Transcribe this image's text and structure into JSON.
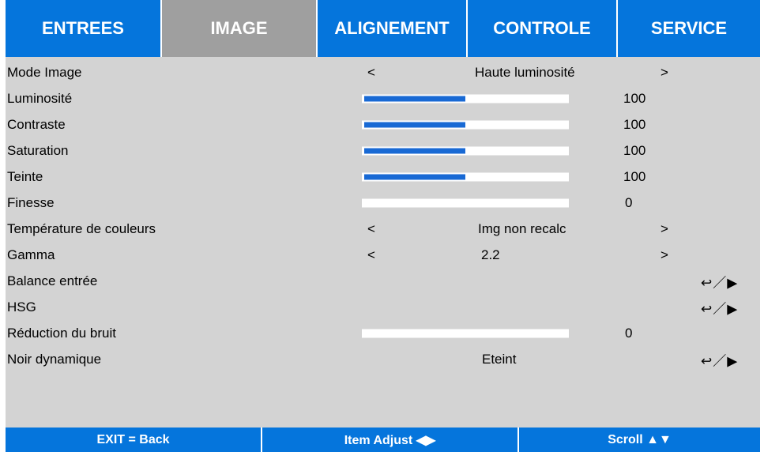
{
  "tabs": [
    {
      "label": "ENTREES",
      "active": false
    },
    {
      "label": "IMAGE",
      "active": true
    },
    {
      "label": "ALIGNEMENT",
      "active": false
    },
    {
      "label": "CONTROLE",
      "active": false
    },
    {
      "label": "SERVICE",
      "active": false
    }
  ],
  "menu": {
    "mode_image": {
      "label": "Mode Image",
      "left": "<",
      "value": "Haute luminosité",
      "right": ">"
    },
    "luminosite": {
      "label": "Luminosité",
      "value": "100",
      "level": 0.5
    },
    "contraste": {
      "label": "Contraste",
      "value": "100",
      "level": 0.5
    },
    "saturation": {
      "label": "Saturation",
      "value": "100",
      "level": 0.5
    },
    "teinte": {
      "label": "Teinte",
      "value": "100",
      "level": 0.5
    },
    "finesse": {
      "label": "Finesse",
      "value": "0",
      "level": 0
    },
    "temperature": {
      "label": "Température de couleurs",
      "left": "<",
      "value": "Img non recalc",
      "right": ">"
    },
    "gamma": {
      "label": "Gamma",
      "left": "<",
      "value": "2.2",
      "right": ">"
    },
    "balance_entree": {
      "label": "Balance entrée",
      "icon": "↩／▶"
    },
    "hsg": {
      "label": "HSG",
      "icon": "↩／▶"
    },
    "reduction_bruit": {
      "label": "Réduction du bruit",
      "value": "0",
      "level": 0
    },
    "noir_dynamique": {
      "label": "Noir dynamique",
      "value": "Eteint",
      "icon": "↩／▶"
    }
  },
  "footer": {
    "exit": "EXIT = Back",
    "adjust": "Item Adjust ◀▶",
    "scroll": "Scroll ▲▼"
  },
  "colors": {
    "tab_blue": "#0575dc",
    "tab_active": "#9f9f9f",
    "panel": "#d3d3d3",
    "slider_fill": "#1869d4"
  }
}
